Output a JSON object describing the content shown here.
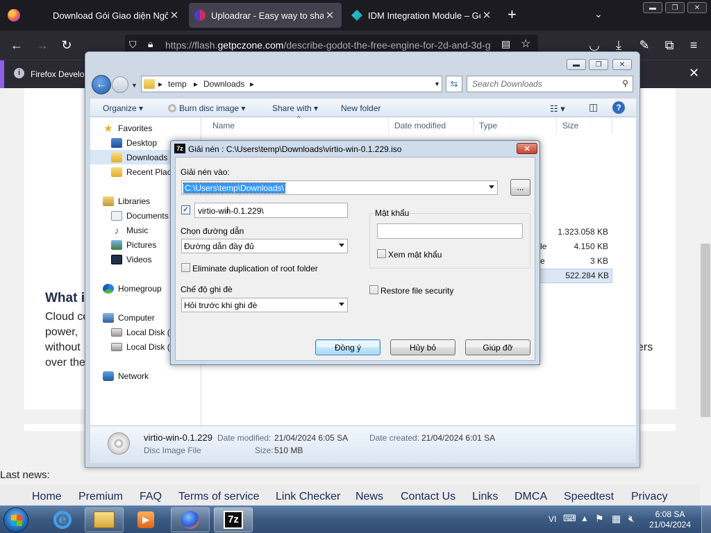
{
  "browser": {
    "tabs": [
      {
        "label": "Download Gói Giao diện Ngôn n"
      },
      {
        "label": "Uploadrar - Easy way to share y"
      },
      {
        "label": "IDM Integration Module – Get th"
      }
    ],
    "new_tab": "+",
    "tab_list": "⌄",
    "url_prefix": "https://flash.",
    "url_domain": "getpczone.com",
    "url_path": "/describe-godot-the-free-engine-for-2d-and-3d-g",
    "notice_text": "Firefox Develop"
  },
  "webpage": {
    "heading": "What i",
    "lines": [
      "Cloud co",
      "power,",
      "without",
      "over the"
    ],
    "right_fragment": "ers",
    "last_news": "Last news:",
    "footer_links": [
      "Home",
      "Premium",
      "FAQ",
      "Terms of service",
      "Link Checker",
      "News",
      "Contact Us",
      "Links",
      "DMCA",
      "Speedtest",
      "Privacy"
    ]
  },
  "explorer": {
    "breadcrumbs": [
      "temp",
      "Downloads"
    ],
    "search_placeholder": "Search Downloads",
    "toolbar": {
      "organize": "Organize",
      "burn": "Burn disc image",
      "share": "Share with",
      "new_folder": "New folder"
    },
    "nav": {
      "favorites": "Favorites",
      "fav_items": [
        "Desktop",
        "Downloads",
        "Recent Places"
      ],
      "libraries": "Libraries",
      "lib_items": [
        "Documents",
        "Music",
        "Pictures",
        "Videos"
      ],
      "homegroup": "Homegroup",
      "computer": "Computer",
      "comp_items": [
        "Local Disk (C:)",
        "Local Disk (D:)"
      ],
      "network": "Network"
    },
    "columns": {
      "name": "Name",
      "date": "Date modified",
      "type": "Type",
      "size": "Size"
    },
    "visible_rows": [
      {
        "type_fragment": "",
        "size": "1.323.058 KB"
      },
      {
        "type_fragment": "le",
        "size": "4.150 KB"
      },
      {
        "type_fragment": "e",
        "size": "3 KB"
      },
      {
        "type_fragment": "",
        "size": "522.284 KB"
      }
    ],
    "details": {
      "filename": "virtio-win-0.1.229",
      "filetype": "Disc Image File",
      "modified_label": "Date modified:",
      "modified_value": "21/04/2024 6:05 SA",
      "size_label": "Size:",
      "size_value": "510 MB",
      "created_label": "Date created:",
      "created_value": "21/04/2024 6:01 SA"
    }
  },
  "dialog": {
    "app_icon": "7z",
    "title": "Giải nén : C:\\Users\\temp\\Downloads\\virtio-win-0.1.229.iso",
    "extract_to_label": "Giải nén vào:",
    "extract_to_value": "C:\\Users\\temp\\Downloads\\",
    "browse_label": "...",
    "subfolder_value": "virtio-win-0.1.229\\",
    "subfolder_checked": true,
    "path_mode_label": "Chọn đường dẫn",
    "path_mode_value": "Đường dẫn đầy đủ",
    "eliminate_label": "Eliminate duplication of root folder",
    "overwrite_label": "Chế độ ghi đè",
    "overwrite_value": "Hỏi trước khi ghi đè",
    "password_label": "Mật khẩu",
    "show_password_label": "Xem mật khẩu",
    "restore_security_label": "Restore file security",
    "ok_label": "Đồng ý",
    "cancel_label": "Hủy bỏ",
    "help_label": "Giúp đỡ"
  },
  "taskbar": {
    "lang": "VI",
    "time": "6:08 SA",
    "date": "21/04/2024"
  }
}
